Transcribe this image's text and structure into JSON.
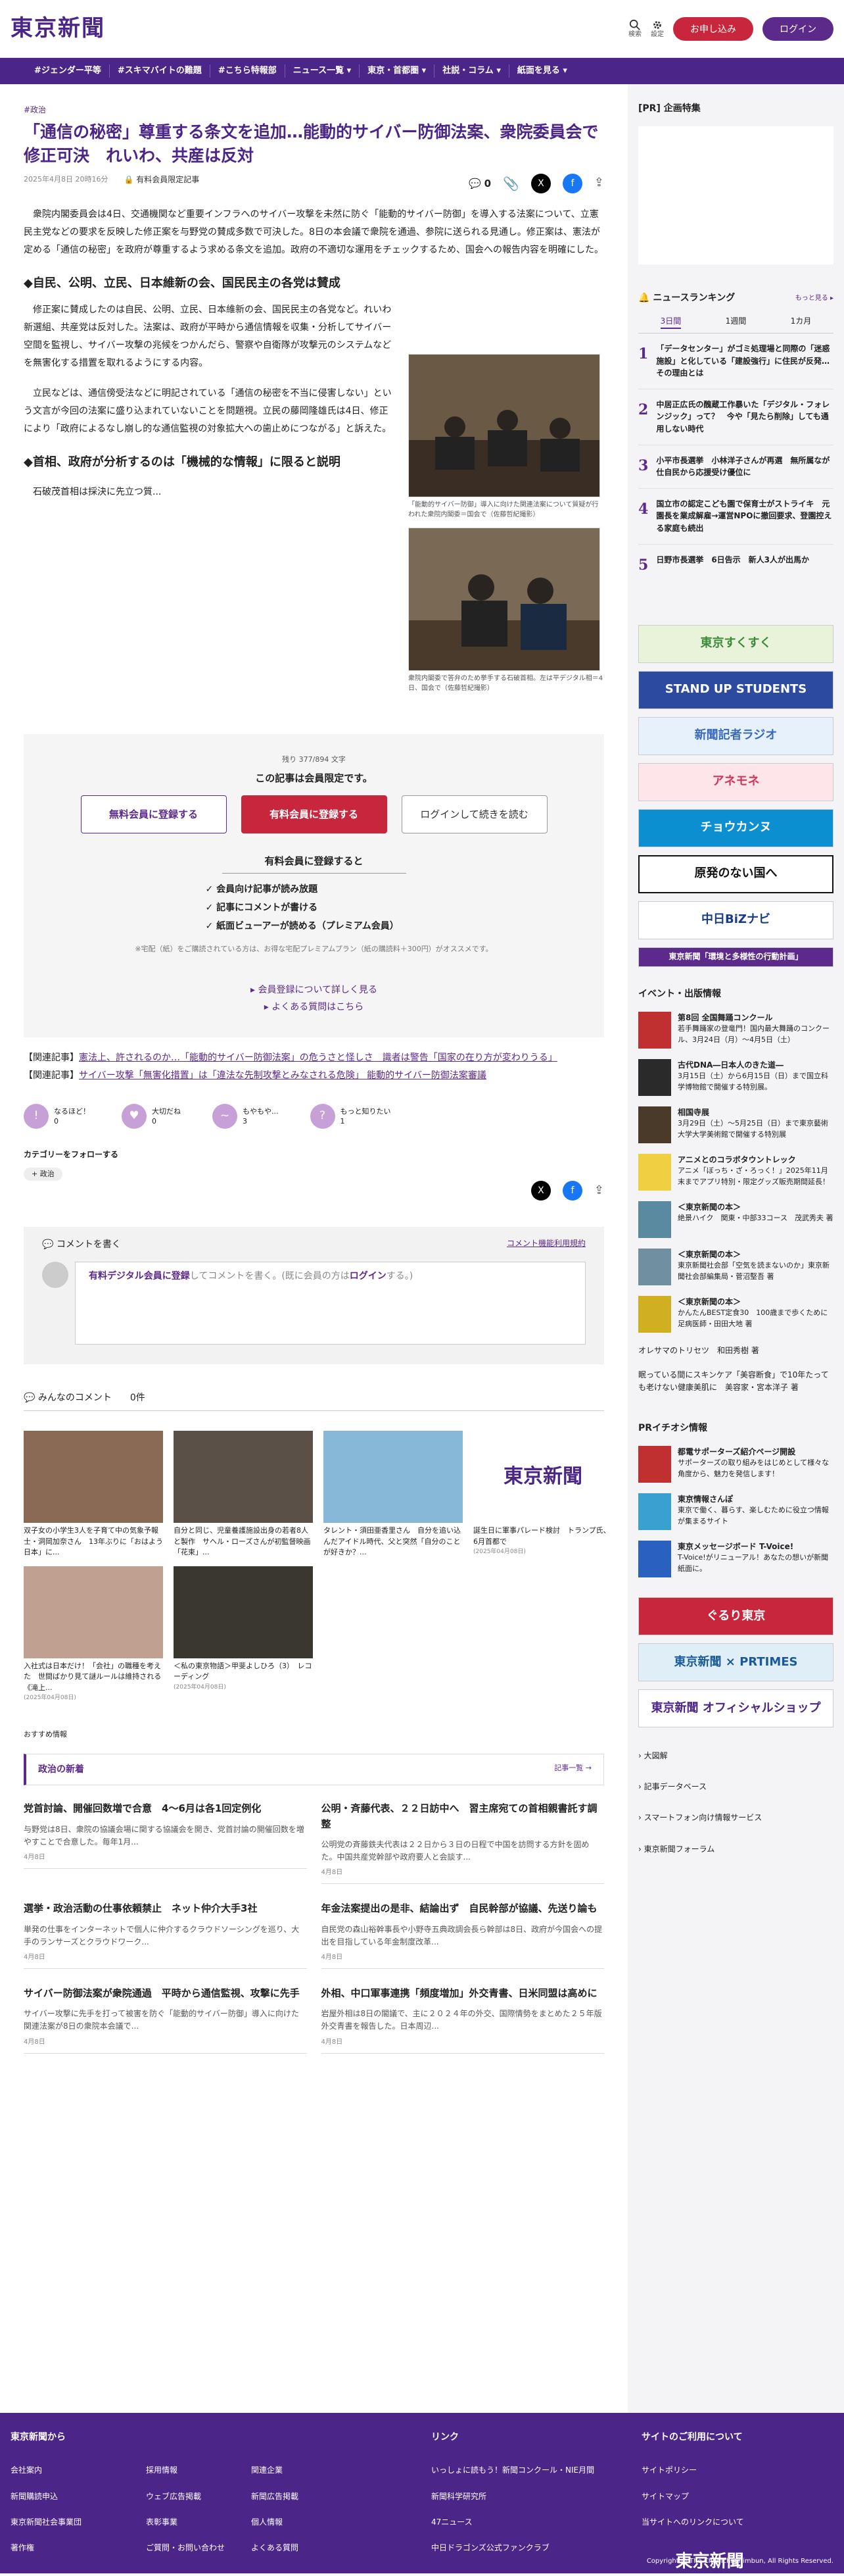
{
  "header": {
    "logo": "東京新聞",
    "search_label": "検索",
    "settings_label": "設定",
    "apply_label": "お申し込み",
    "login_label": "ログイン"
  },
  "nav": [
    "#ジェンダー平等",
    "#スキマバイトの難題",
    "#こちら特報部",
    "ニュース一覧 ▾",
    "東京・首都圏 ▾",
    "社説・コラム ▾",
    "紙面を見る ▾"
  ],
  "article": {
    "category": "#政治",
    "title": "「通信の秘密」尊重する条文を追加…能動的サイバー防御法案、衆院委員会で修正可決　れいわ、共産は反対",
    "date": "2025年4月8日 20時16分",
    "lock_label": "有料会員限定記事",
    "comment_count": "0",
    "p1": "衆院内閣委員会は4日、交通機関など重要インフラへのサイバー攻撃を未然に防ぐ「能動的サイバー防御」を導入する法案について、立憲民主党などの要求を反映した修正案を与野党の賛成多数で可決した。8日の本会議で衆院を通過、参院に送られる見通し。修正案は、憲法が定める「通信の秘密」を政府が尊重するよう求める条文を追加。政府の不適切な運用をチェックするため、国会への報告内容を明確にした。",
    "h2a": "◆自民、公明、立民、日本維新の会、国民民主の各党は賛成",
    "p2": "修正案に賛成したのは自民、公明、立民、日本維新の会、国民民主の各党など。れいわ新選組、共産党は反対した。法案は、政府が平時から通信情報を収集・分析してサイバー空間を監視し、サイバー攻撃の兆候をつかんだら、警察や自衛隊が攻撃元のシステムなどを無害化する措置を取れるようにする内容。",
    "p3": "立民などは、通信傍受法などに明記されている「通信の秘密を不当に侵害しない」という文言が今回の法案に盛り込まれていないことを問題視。立民の藤岡隆雄氏は4日、修正により「政府によるなし崩し的な通信監視の対象拡大への歯止めにつながる」と訴えた。",
    "h2b": "◆首相、政府が分析するのは「機械的な情報」に限ると説明",
    "p4": "石破茂首相は採決に先立つ質...",
    "cap1": "「能動的サイバー防御」導入に向けた関連法案について質疑が行われた衆院内閣委＝国会で（佐藤哲紀撮影）",
    "cap2": "衆院内閣委で答弁のため挙手する石破首相。左は平デジタル相＝4日、国会で（佐藤哲紀撮影）"
  },
  "paywall": {
    "remaining": "残り 377/894 文字",
    "lead": "この記事は会員限定です。",
    "btn_free": "無料会員に登録する",
    "btn_paid": "有料会員に登録する",
    "btn_login": "ログインして続きを読む",
    "benefit_title": "有料会員に登録すると",
    "benefits": [
      "会員向け記事が読み放題",
      "記事にコメントが書ける",
      "紙面ビューアーが読める（プレミアム会員）"
    ],
    "note": "※宅配（紙）をご購読されている方は、お得な宅配プレミアムプラン（紙の購読料＋300円）がオススメです。",
    "link1": "▸ 会員登録について詳しく見る",
    "link2": "▸ よくある質問はこちら"
  },
  "related": [
    {
      "prefix": "【関連記事】",
      "text": "憲法上、許されるのか…「能動的サイバー防御法案」の危うさと怪しさ　識者は警告「国家の在り方が変わりうる」"
    },
    {
      "prefix": "【関連記事】",
      "text": "サイバー攻撃「無害化措置」は「違法な先制攻撃とみなされる危険」 能動的サイバー防御法案審議"
    }
  ],
  "reactions": [
    {
      "label": "なるほど！",
      "count": "0",
      "icon": "!"
    },
    {
      "label": "大切だね",
      "count": "0",
      "icon": "♥"
    },
    {
      "label": "もやもや...",
      "count": "3",
      "icon": "~"
    },
    {
      "label": "もっと知りたい",
      "count": "1",
      "icon": "?"
    }
  ],
  "follow": {
    "title": "カテゴリーをフォローする",
    "chip": "政治"
  },
  "comment_box": {
    "title": "コメントを書く",
    "rules": "コメント機能利用規約",
    "placeholder_strong": "有料デジタル会員に登録",
    "placeholder_rest": "してコメントを書く。(既に会員の方は",
    "placeholder_login": "ログイン",
    "placeholder_end": "する。)"
  },
  "comments_label": "みんなのコメント",
  "comments_count": "0件",
  "pr_cards": [
    {
      "text": "双子女の小学生3人を子育て中の気象予報士・洞岡加奈さん　13年ぶりに「おはよう日本」に...",
      "date": "",
      "color": "#8a6a55"
    },
    {
      "text": "自分と同じ、児童養護施設出身の若者8人と製作　サヘル・ローズさんが初監督映画「花束」...",
      "date": "",
      "color": "#5a5048"
    },
    {
      "text": "タレント・須田亜香里さん　自分を追い込んだアイドル時代、父と突然「自分のことが好きか？...",
      "date": "",
      "color": "#88b8d8"
    },
    {
      "text": "誕生日に軍事パレード検討　トランプ氏、6月首都で",
      "date": "(2025年04月08日)",
      "color": "#ffffff"
    },
    {
      "text": "入社式は日本だけ！「会社」の職種を考えた　世間ばかり見て謎ルールは維持される《滝上...",
      "date": "(2025年04月08日)",
      "color": "#c0a090"
    },
    {
      "text": "＜私の東京物語＞甲斐よしひろ（3）　レコーディング",
      "date": "(2025年04月08日)",
      "color": "#3a3630"
    }
  ],
  "osusume": "おすすめ情報",
  "politics_news": {
    "title": "政治の新着",
    "more": "記事一覧 →",
    "items": [
      {
        "title": "党首討論、開催回数増で合意　4～6月は各1回定例化",
        "body": "与野党は8日、衆院の協議会場に関する協議会を開き、党首討論の開催回数を増やすことで合意した。毎年1月...",
        "date": "4月8日"
      },
      {
        "title": "公明・斉藤代表、２２日訪中へ　習主席宛ての首相親書託す調整",
        "body": "公明党の斉藤鉄夫代表は２２日から３日の日程で中国を訪問する方針を固めた。中国共産党幹部や政府要人と会談す...",
        "date": "4月8日"
      },
      {
        "title": "選挙・政治活動の仕事依頼禁止　ネット仲介大手3社",
        "body": "単発の仕事をインターネットで個人に仲介するクラウドソーシングを巡り、大手のランサーズとクラウドワーク...",
        "date": "4月8日"
      },
      {
        "title": "年金法案提出の是非、結論出ず　自民幹部が協議、先送り論も",
        "body": "自民党の森山裕幹事長や小野寺五典政調会長ら幹部は8日、政府が今国会への提出を目指している年金制度改革...",
        "date": "4月8日"
      },
      {
        "title": "サイバー防御法案が衆院通過　平時から通信監視、攻撃に先手",
        "body": "サイバー攻撃に先手を打って被害を防ぐ「能動的サイバー防御」導入に向けた関連法案が8日の衆院本会議で...",
        "date": "4月8日"
      },
      {
        "title": "外相、中口軍事連携「頻度増加」外交青書、日米同盟は高めに",
        "body": "岩屋外相は8日の閣議で、主に２０２４年の外交、国際情勢をまとめた２５年版外交青書を報告した。日本周辺...",
        "date": "4月8日"
      }
    ]
  },
  "side": {
    "pr_title": "[PR] 企画特集",
    "ranking_title": "ニュースランキング",
    "ranking_more": "もっと見る ▸",
    "tabs": [
      "3日間",
      "1週間",
      "1カ月"
    ],
    "ranking": [
      {
        "n": "1",
        "text": "「データセンター」がゴミ処理場と同際の「迷惑施設」と化している「建設強行」に住民が反発…その理由とは"
      },
      {
        "n": "2",
        "text": "中居正広氏の醜蔵工作暴いた「デジタル・フォレンジック」って？　今や「見たら削除」しても通用しない時代"
      },
      {
        "n": "3",
        "text": "小平市長選挙　小林洋子さんが再選　無所属なが仕自民から応援受け優位に"
      },
      {
        "n": "4",
        "text": "国立市の認定こども園で保育士がストライキ　元園長を業成解雇→運営NPOに撤回要求、登園控える家庭も続出"
      },
      {
        "n": "5",
        "text": "日野市長選挙　6日告示　新人3人が出馬か"
      }
    ],
    "banners": [
      {
        "label": "東京すくすく",
        "bg": "#e8f3d9",
        "fg": "#3a8a3a"
      },
      {
        "label": "STAND UP STUDENTS",
        "bg": "#2c4aa0",
        "fg": "#ffffff"
      },
      {
        "label": "新聞記者ラジオ",
        "bg": "#e6f1fb",
        "fg": "#3a6ac0"
      },
      {
        "label": "アネモネ",
        "bg": "#fde5ea",
        "fg": "#d0365a"
      },
      {
        "label": "チョウカンヌ",
        "bg": "#0b8fd0",
        "fg": "#ffffff"
      },
      {
        "label": "原発のない国へ",
        "bg": "#ffffff",
        "fg": "#111111"
      },
      {
        "label": "中日BiZナビ",
        "bg": "#ffffff",
        "fg": "#1a3a8a"
      },
      {
        "label": "東京新聞「環境と多様性の行動計画」",
        "bg": "#5c2a8a",
        "fg": "#ffffff"
      }
    ],
    "events_title": "イベント・出版情報",
    "events": [
      {
        "title": "第8回 全国舞踊コンクール",
        "body": "若手舞踊家の登竜門！国内最大舞踊のコンクール、3月24日（月）～4月5日（土）",
        "color": "#c03030"
      },
      {
        "title": "古代DNA―日本人のきた道―",
        "body": "3月15日（土）から6月15日（日）まで国立科学博物館で開催する特別展。",
        "color": "#2a2a2a"
      },
      {
        "title": "相国寺展",
        "body": "3月29日（土）～5月25日（日）まで東京藝術大学大学美術館で開催する特別展",
        "color": "#4a3a2a"
      },
      {
        "title": "アニメとのコラボタウントレック",
        "body": "アニメ「ぼっち・ざ・ろっく！」2025年11月末までアプリ特別・限定グッズ販売期間延長！",
        "color": "#f0d040"
      },
      {
        "title": "＜東京新聞の本＞",
        "body": "絶景ハイク　関東・中部33コース　茂武秀夫 著",
        "color": "#5a8aa0"
      },
      {
        "title": "＜東京新聞の本＞",
        "body": "東京新聞社会部「空気を読まないのか」東京新聞社会部編集局・菅沼堅吾 著",
        "color": "#7090a0"
      },
      {
        "title": "＜東京新聞の本＞",
        "body": "かんたんBEST定食30　100歳まで歩くために　足病医師・田田大地 著",
        "color": "#d0b020"
      }
    ],
    "plain": [
      "オレサマのトリセツ　和田秀樹 著",
      "眠っている間にスキンケア「美容断食」で10年たっても老けない健康美肌に　美容家・宮本洋子 著"
    ],
    "pr_info_title": "PRイチオシ情報",
    "pr_info": [
      {
        "title": "都電サポーターズ紹介ページ開設",
        "body": "サポーターズの取り組みをはじめとして様々な角度から、魅力を発信します！",
        "color": "#c03030"
      },
      {
        "title": "東京情報さんぽ",
        "body": "東京で働く、暮らす、楽しむために役立つ情報が集まるサイト",
        "color": "#3aa0d0"
      },
      {
        "title": "東京メッセージボード T-Voice!",
        "body": "T-Voice!がリニューアル！あなたの想いが新聞紙面に。",
        "color": "#2a60c0"
      }
    ],
    "big_banners": [
      {
        "label": "ぐるり東京",
        "bg": "#c8263c",
        "fg": "#ffffff"
      },
      {
        "label": "東京新聞 × PRTIMES",
        "bg": "#e0eef8",
        "fg": "#1a5a9a"
      },
      {
        "label": "東京新聞 オフィシャルショップ",
        "bg": "#ffffff",
        "fg": "#4b2588"
      }
    ],
    "links": [
      "大図解",
      "記事データベース",
      "スマートフォン向け情報サービス",
      "東京新聞フォーラム"
    ]
  },
  "footer": {
    "col1_title": "東京新聞から",
    "col1": [
      "会社案内",
      "採用情報",
      "関連企業",
      "新聞購読申込",
      "ウェブ広告掲載",
      "新聞広告掲載",
      "東京新聞社会事業団",
      "表彰事業",
      "個人情報",
      "著作権",
      "ご質問・お問い合わせ",
      "よくある質問"
    ],
    "col2_title": "リンク",
    "col2": [
      "いっしょに読もう！新聞コンクール・NIE月間",
      "新聞科学研究所",
      "47ニュース",
      "中日ドラゴンズ公式ファンクラブ"
    ],
    "col3_title": "サイトのご利用について",
    "col3": [
      "サイトポリシー",
      "サイトマップ",
      "当サイトへのリンクについて"
    ],
    "logo": "東京新聞",
    "copyright": "Copyright © The Chunichi Shimbun, All Rights Reserved."
  }
}
